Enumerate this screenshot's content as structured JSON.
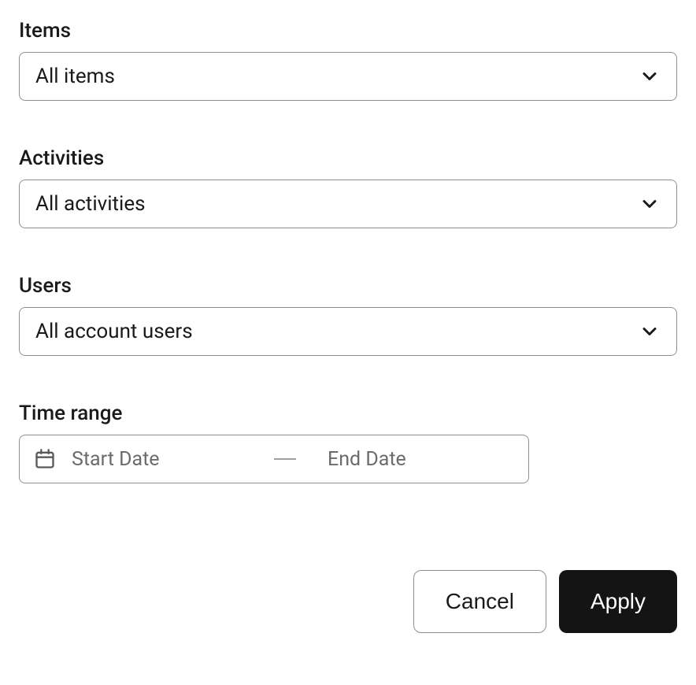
{
  "fields": {
    "items": {
      "label": "Items",
      "value": "All items"
    },
    "activities": {
      "label": "Activities",
      "value": "All activities"
    },
    "users": {
      "label": "Users",
      "value": "All account users"
    },
    "timeRange": {
      "label": "Time range",
      "startPlaceholder": "Start Date",
      "endPlaceholder": "End Date"
    }
  },
  "buttons": {
    "cancel": "Cancel",
    "apply": "Apply"
  }
}
